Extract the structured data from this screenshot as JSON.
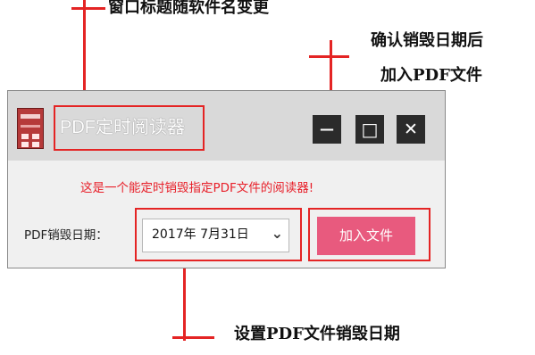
{
  "annotations": {
    "title_note": "窗口标题随软件名变更",
    "add_note_line1": "确认销毁日期后",
    "add_note_line2": "加入PDF文件",
    "date_note": "设置PDF文件销毁日期"
  },
  "window": {
    "title": "PDF定时阅读器",
    "minimize_glyph": "—",
    "maximize_glyph": "□",
    "close_glyph": "✕"
  },
  "main": {
    "warning": "这是一个能定时销毁指定PDF文件的阅读器!",
    "date_label": "PDF销毁日期：",
    "date_value": "2017年  7月31日",
    "dropdown_glyph": "⌄",
    "add_button": "加入文件"
  },
  "colors": {
    "annotation_red": "#e42424",
    "button_pink": "#e85a7e",
    "warning_red": "#e8202a"
  }
}
